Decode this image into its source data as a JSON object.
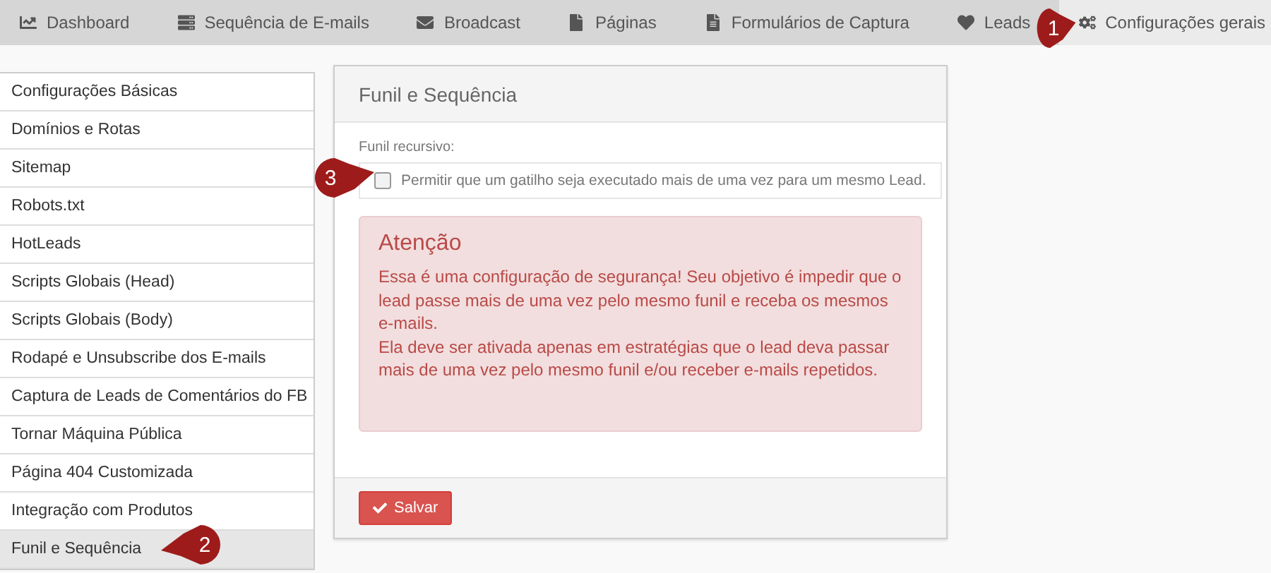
{
  "nav": [
    {
      "label": "Dashboard",
      "selected": false
    },
    {
      "label": "Sequência de E-mails",
      "selected": false
    },
    {
      "label": "Broadcast",
      "selected": false
    },
    {
      "label": "Páginas",
      "selected": false
    },
    {
      "label": "Formulários de Captura",
      "selected": false
    },
    {
      "label": "Leads",
      "selected": false
    },
    {
      "label": "Configurações gerais",
      "selected": true
    }
  ],
  "sidebar": {
    "items": [
      {
        "label": "Configurações Básicas",
        "selected": false
      },
      {
        "label": "Domínios e Rotas",
        "selected": false
      },
      {
        "label": "Sitemap",
        "selected": false
      },
      {
        "label": "Robots.txt",
        "selected": false
      },
      {
        "label": "HotLeads",
        "selected": false
      },
      {
        "label": "Scripts Globais (Head)",
        "selected": false
      },
      {
        "label": "Scripts Globais (Body)",
        "selected": false
      },
      {
        "label": "Rodapé e Unsubscribe dos E-mails",
        "selected": false
      },
      {
        "label": "Captura de Leads de Comentários do FB",
        "selected": false
      },
      {
        "label": "Tornar Máquina Pública",
        "selected": false
      },
      {
        "label": "Página 404 Customizada",
        "selected": false
      },
      {
        "label": "Integração com Produtos",
        "selected": false
      },
      {
        "label": "Funil e Sequência",
        "selected": true
      }
    ]
  },
  "panel": {
    "title": "Funil e Sequência",
    "field_label": "Funil recursivo:",
    "checkbox": {
      "label": "Permitir que um gatilho seja executado mais de uma vez para um mesmo Lead.",
      "checked": false
    },
    "alert": {
      "title": "Atenção",
      "paragraphs": [
        "Essa é uma configuração de segurança! Seu objetivo é impedir que o lead passe mais de uma vez pelo mesmo funil e receba os mesmos e-mails.",
        "Ela deve ser ativada apenas em estratégias que o lead deva passar mais de uma vez pelo mesmo funil e/ou receber e-mails repetidos."
      ]
    },
    "save_button": "Salvar"
  },
  "callouts": [
    {
      "number": "1"
    },
    {
      "number": "2"
    },
    {
      "number": "3"
    }
  ]
}
